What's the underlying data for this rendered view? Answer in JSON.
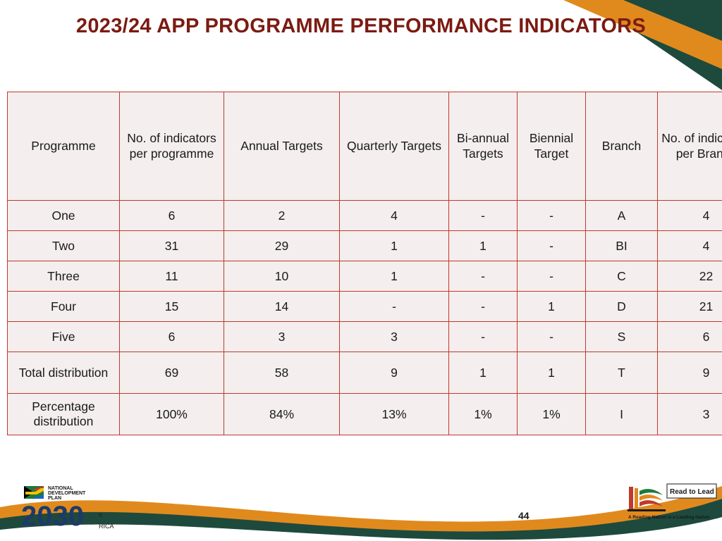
{
  "slide": {
    "title": "2023/24 APP PROGRAMME PERFORMANCE INDICATORS",
    "page_number": "44",
    "accent_color": "#7b1b12",
    "table_border_color": "#c0392b",
    "table_fill_color": "#f4eeee"
  },
  "table": {
    "headers": [
      "Programme",
      "No. of indicators per programme",
      "Annual Targets",
      "Quarterly Targets",
      "Bi-annual Targets",
      "Biennial Target",
      "Branch",
      "No. of indicators per Branch"
    ],
    "rows": [
      [
        "One",
        "6",
        "2",
        "4",
        "-",
        "-",
        "A",
        "4"
      ],
      [
        "Two",
        "31",
        "29",
        "1",
        "1",
        "-",
        "BI",
        "4"
      ],
      [
        "Three",
        "11",
        "10",
        "1",
        "-",
        "-",
        "C",
        "22"
      ],
      [
        "Four",
        "15",
        "14",
        "-",
        "-",
        "1",
        "D",
        "21"
      ],
      [
        "Five",
        "6",
        "3",
        "3",
        "-",
        "-",
        "S",
        "6"
      ],
      [
        "Total distribution",
        "69",
        "58",
        "9",
        "1",
        "1",
        "T",
        "9"
      ],
      [
        "Percentage distribution",
        "100%",
        "84%",
        "13%",
        "1%",
        "1%",
        "I",
        "3"
      ]
    ]
  },
  "logos": {
    "ndp": {
      "line1": "NATIONAL",
      "line2": "DEVELOPMENT",
      "line3": "PLAN",
      "number": "2030",
      "country_fragment": "RICA",
      "small_fragment": "n"
    },
    "read_to_lead": {
      "title": "Read to Lead",
      "tagline": "A Reading Nation is a Leading Nation"
    }
  }
}
